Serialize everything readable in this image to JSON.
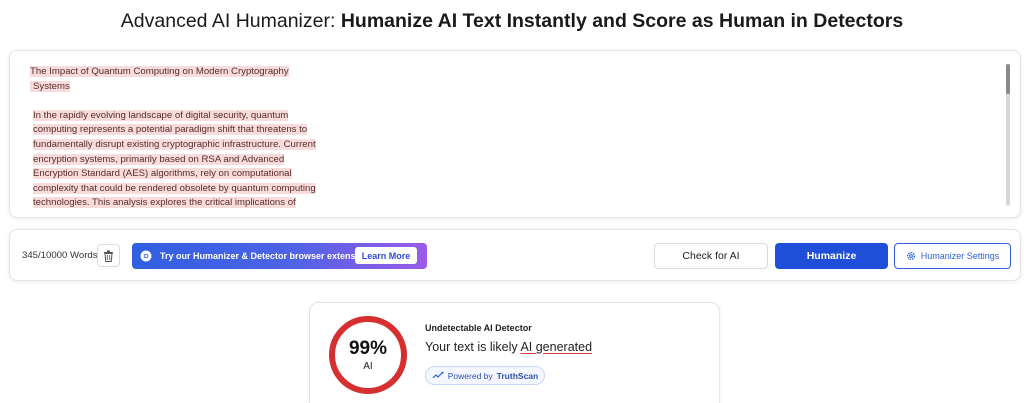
{
  "header": {
    "title_regular": "Advanced AI Humanizer:",
    "title_bold": "Humanize AI Text Instantly and Score as Human in Detectors"
  },
  "editor": {
    "doc_title_line1": "The Impact of Quantum Computing on Modern Cryptography",
    "doc_title_line2": "Systems",
    "paragraph_lines": [
      "In the rapidly evolving landscape of digital security, quantum",
      "computing represents a potential paradigm shift that threatens to",
      "fundamentally disrupt existing cryptographic infrastructure. Current",
      "encryption systems, primarily based on RSA and Advanced",
      "Encryption Standard (AES) algorithms, rely on computational",
      "complexity that could be rendered obsolete by quantum computing",
      "technologies. This analysis explores the critical implications of"
    ],
    "highlight_color": "#f8dcdc"
  },
  "toolbar": {
    "word_count": "345/10000 Words",
    "extension_banner": "Try our Humanizer & Detector browser extension",
    "learn_more": "Learn More",
    "check_label": "Check for AI",
    "humanize_label": "Humanize",
    "settings_label": "Humanizer Settings"
  },
  "result": {
    "percent": "99%",
    "percent_value": 99,
    "gauge_label": "AI",
    "detector_title": "Undetectable AI Detector",
    "result_prefix": "Your text is likely",
    "result_verdict": "AI generated",
    "powered_prefix": "Powered by",
    "powered_brand": "TruthScan",
    "gauge_color": "#d62f2f"
  },
  "colors": {
    "accent": "#1f4fd8",
    "danger": "#d62f2f"
  },
  "icons": {
    "trash": "trash-icon",
    "extension": "chrome-icon",
    "settings": "gear-icon",
    "powered": "sparkle-icon"
  }
}
